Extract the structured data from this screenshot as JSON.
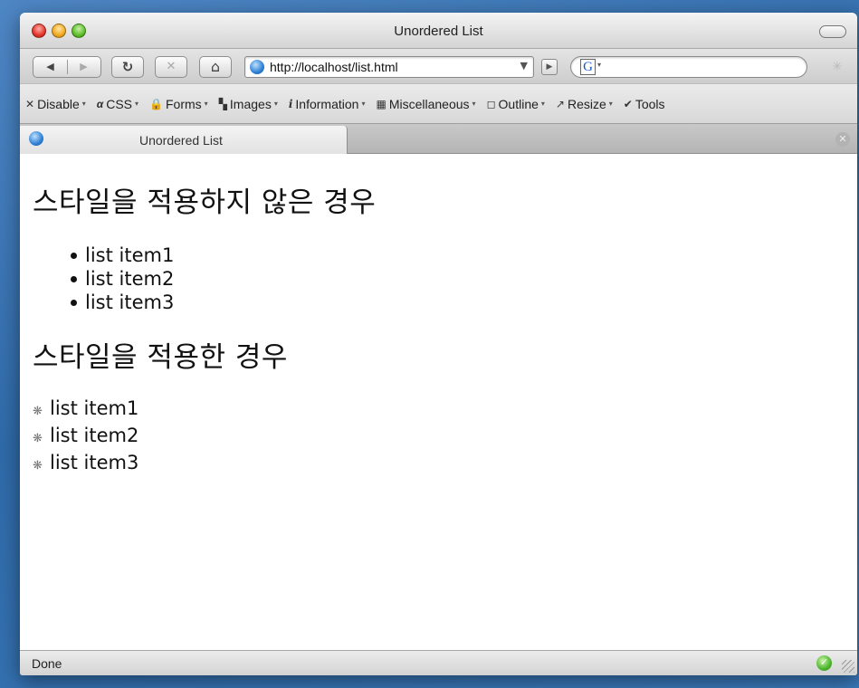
{
  "window": {
    "title": "Unordered List"
  },
  "toolbar": {
    "back_label": "◀",
    "forward_label": "▶",
    "reload_label": "↻",
    "stop_label": "✕",
    "home_label": "⌂",
    "url": "http://localhost/list.html",
    "url_dropdown": "▼",
    "go_label": "▶",
    "search_engine_logo": "G",
    "search_dropdown": "▾",
    "search_value": ""
  },
  "devbar": {
    "items": [
      {
        "icon": "✕",
        "label": "Disable"
      },
      {
        "icon": "α",
        "label": "CSS"
      },
      {
        "icon": "🔒",
        "label": "Forms"
      },
      {
        "icon": "▚",
        "label": "Images"
      },
      {
        "icon": "i",
        "label": "Information"
      },
      {
        "icon": "▦",
        "label": "Miscellaneous"
      },
      {
        "icon": "◻",
        "label": "Outline"
      },
      {
        "icon": "↗",
        "label": "Resize"
      },
      {
        "icon": "✔",
        "label": "Tools"
      }
    ],
    "dropdown_arrow": "▾"
  },
  "tabs": [
    {
      "label": "Unordered List",
      "close": "✕"
    }
  ],
  "content": {
    "heading1": "스타일을 적용하지 않은 경우",
    "list1": [
      "list item1",
      "list item2",
      "list item3"
    ],
    "heading2": "스타일을 적용한 경우",
    "list2": [
      "list item1",
      "list item2",
      "list item3"
    ],
    "list2_marker": "❋"
  },
  "status": {
    "text": "Done",
    "check": "✓"
  },
  "colors": {
    "desktop": "#3a78b8",
    "link_globe": "#2d7fd3",
    "status_ok": "#4cb52b"
  }
}
